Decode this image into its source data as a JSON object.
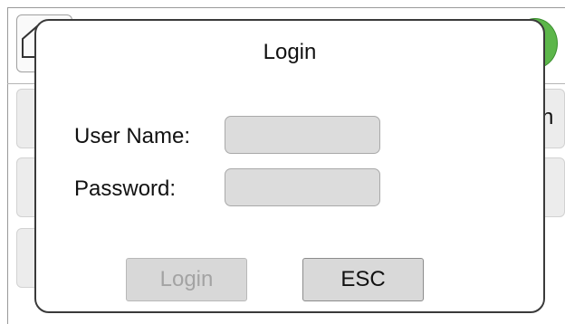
{
  "background": {
    "right_button_partial_text": "n",
    "status_color": "#5cb64a"
  },
  "login_dialog": {
    "title": "Login",
    "username_label": "User Name:",
    "username_value": "",
    "password_label": "Password:",
    "password_value": "",
    "login_button_label": "Login",
    "login_button_enabled": false,
    "esc_button_label": "ESC"
  }
}
